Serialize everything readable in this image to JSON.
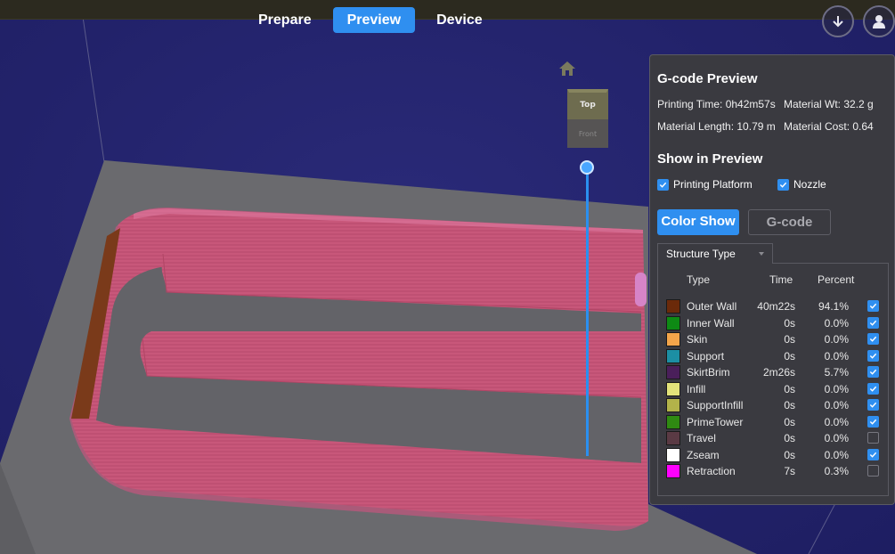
{
  "nav": {
    "tabs": [
      {
        "label": "Prepare",
        "active": false
      },
      {
        "label": "Preview",
        "active": true
      },
      {
        "label": "Device",
        "active": false
      }
    ]
  },
  "viewcube": {
    "top": "Top",
    "front": "Front"
  },
  "panel": {
    "title": "G-code Preview",
    "printing_time": "Printing Time: 0h42m57s",
    "material_wt": "Material Wt: 32.2 g",
    "material_length": "Material Length: 10.79 m",
    "material_cost": "Material Cost: 0.64",
    "show_title": "Show in Preview",
    "show_platform": "Printing Platform",
    "show_nozzle": "Nozzle",
    "btn_color_show": "Color Show",
    "btn_gcode": "G-code",
    "structure_dropdown": "Structure Type",
    "col_type": "Type",
    "col_time": "Time",
    "col_percent": "Percent",
    "rows": [
      {
        "name": "Outer Wall",
        "time": "40m22s",
        "pct": "94.1%",
        "color": "#6b2a0a",
        "checked": true
      },
      {
        "name": "Inner Wall",
        "time": "0s",
        "pct": "0.0%",
        "color": "#0e8a14",
        "checked": true
      },
      {
        "name": "Skin",
        "time": "0s",
        "pct": "0.0%",
        "color": "#f4a54a",
        "checked": true
      },
      {
        "name": "Support",
        "time": "0s",
        "pct": "0.0%",
        "color": "#1c8fa4",
        "checked": true
      },
      {
        "name": "SkirtBrim",
        "time": "2m26s",
        "pct": "5.7%",
        "color": "#4a1f5a",
        "checked": true
      },
      {
        "name": "Infill",
        "time": "0s",
        "pct": "0.0%",
        "color": "#e2e27a",
        "checked": true
      },
      {
        "name": "SupportInfill",
        "time": "0s",
        "pct": "0.0%",
        "color": "#b3b34a",
        "checked": true
      },
      {
        "name": "PrimeTower",
        "time": "0s",
        "pct": "0.0%",
        "color": "#2f8a12",
        "checked": true
      },
      {
        "name": "Travel",
        "time": "0s",
        "pct": "0.0%",
        "color": "#5a3a44",
        "checked": false
      },
      {
        "name": "Zseam",
        "time": "0s",
        "pct": "0.0%",
        "color": "#ffffff",
        "checked": true
      },
      {
        "name": "Retraction",
        "time": "7s",
        "pct": "0.3%",
        "color": "#ff00ff",
        "checked": false
      }
    ]
  }
}
